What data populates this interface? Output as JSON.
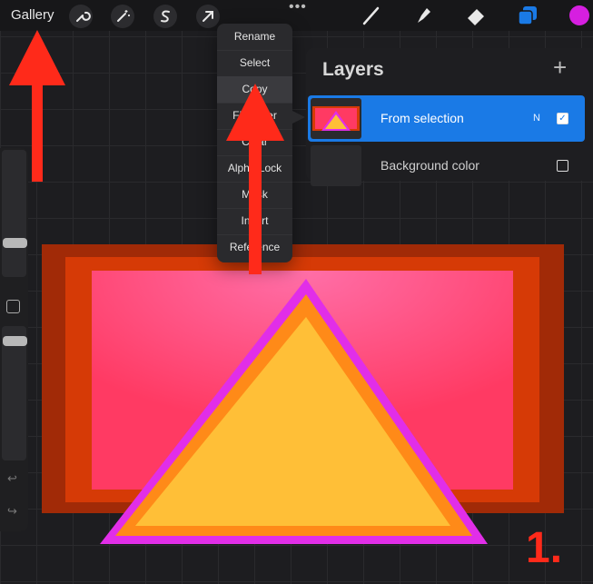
{
  "toolbar": {
    "gallery_label": "Gallery",
    "more_label": "•••",
    "icons": [
      "wrench-icon",
      "magic-wand-icon",
      "selection-icon",
      "transform-arrow-icon",
      "brush-icon",
      "smudge-icon",
      "eraser-icon",
      "layers-icon"
    ],
    "color_swatch": "#d61fe0"
  },
  "menu": {
    "items": [
      "Rename",
      "Select",
      "Copy",
      "Fill Layer",
      "Clear",
      "Alpha Lock",
      "Mask",
      "Invert",
      "Reference"
    ]
  },
  "layers_panel": {
    "title": "Layers",
    "add_label": "+",
    "layers": [
      {
        "name": "From selection",
        "mode": "N",
        "visible": true,
        "selected": true
      },
      {
        "name": "Background color",
        "mode": "",
        "visible": false,
        "selected": false
      }
    ]
  },
  "sidebar": {
    "undo_label": "↩",
    "redo_label": "↪"
  },
  "annotation": {
    "step_label": "1.",
    "arrow_color": "#ff2a1a"
  },
  "colors": {
    "accent": "#1a7ae6",
    "rect_outer": "#a12a07",
    "rect_mid": "#d63a06",
    "rect_inner": "#ff3a63",
    "tri_outer": "#e12ee8",
    "tri_mid": "#ff8a18",
    "tri_inner": "#ffbf37"
  }
}
